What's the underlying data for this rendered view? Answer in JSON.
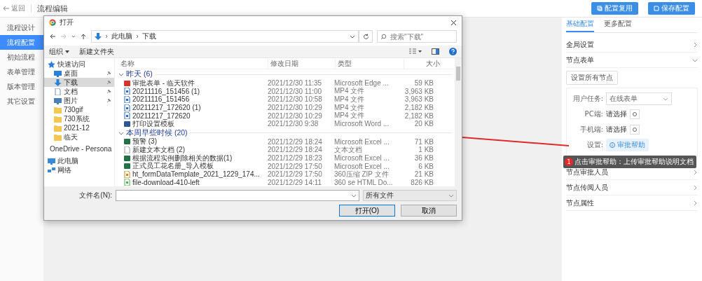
{
  "topbar": {
    "back": "返回",
    "title": "流程编辑",
    "buttons": [
      {
        "label": "配置复用",
        "kind": "copy"
      },
      {
        "label": "保存配置",
        "kind": "save"
      }
    ]
  },
  "sidebar": {
    "items": [
      {
        "label": "流程设计",
        "selected": false
      },
      {
        "label": "流程配置",
        "selected": true
      },
      {
        "label": "初始流程",
        "selected": false
      },
      {
        "label": "表单管理",
        "selected": false
      },
      {
        "label": "版本管理",
        "selected": false
      },
      {
        "label": "其它设置",
        "selected": false
      }
    ]
  },
  "panel": {
    "tabs": [
      {
        "label": "基础配置",
        "selected": true
      },
      {
        "label": "更多配置",
        "selected": false
      }
    ],
    "sections": [
      {
        "title": "全局设置",
        "expanded": false
      },
      {
        "title": "节点表单",
        "expanded": true,
        "content": {
          "button": "设置所有节点",
          "fields": [
            {
              "label": "用户任务:",
              "kind": "select",
              "value": "在线表单"
            },
            {
              "label": "PC端:",
              "kind": "picker",
              "value": "请选择"
            },
            {
              "label": "手机端:",
              "kind": "picker",
              "value": "请选择"
            },
            {
              "label": "设置:",
              "kind": "button",
              "value": "审批帮助"
            }
          ]
        }
      },
      {
        "title": "节点审批人员",
        "expanded": false
      },
      {
        "title": "节点传阅人员",
        "expanded": false
      },
      {
        "title": "节点属性",
        "expanded": false
      }
    ],
    "tooltip": {
      "badge": "1",
      "text": "点击审批帮助：上传审批帮助说明文档"
    }
  },
  "dialog": {
    "title": "打开",
    "path": [
      "此电脑",
      "下载"
    ],
    "search": {
      "placeholder": "搜索\"下载\""
    },
    "toolbar": [
      "组织",
      "新建文件夹"
    ],
    "nav": [
      {
        "label": "快速访问",
        "kind": "star",
        "pinned": false,
        "selected": false
      },
      {
        "label": "桌面",
        "kind": "desktop",
        "pinned": true,
        "selected": false
      },
      {
        "label": "下载",
        "kind": "download",
        "pinned": true,
        "selected": true
      },
      {
        "label": "文档",
        "kind": "document",
        "pinned": true,
        "selected": false
      },
      {
        "label": "图片",
        "kind": "picture",
        "pinned": true,
        "selected": false
      },
      {
        "label": "730gif",
        "kind": "folder",
        "pinned": false,
        "selected": false
      },
      {
        "label": "730系统",
        "kind": "folder",
        "pinned": false,
        "selected": false
      },
      {
        "label": "2021-12",
        "kind": "folder",
        "pinned": false,
        "selected": false
      },
      {
        "label": "临天",
        "kind": "folder",
        "pinned": false,
        "selected": false
      },
      {
        "label": "OneDrive - Persona",
        "kind": "cloud",
        "pinned": false,
        "selected": false
      },
      {
        "label": "此电脑",
        "kind": "computer",
        "pinned": false,
        "selected": false
      },
      {
        "label": "网络",
        "kind": "network",
        "pinned": false,
        "selected": false
      }
    ],
    "columns": [
      "名称",
      "修改日期",
      "类型",
      "大小"
    ],
    "groups": [
      {
        "label": "昨天 (6)",
        "expanded": true,
        "files": [
          {
            "name": "审批表单 - 临天软件",
            "date": "2021/12/30 11:35",
            "type": "Microsoft Edge ...",
            "size": "59 KB",
            "kind": "pdf"
          },
          {
            "name": "20211116_151456 (1)",
            "date": "2021/12/30 11:00",
            "type": "MP4 文件",
            "size": "3,963 KB",
            "kind": "video"
          },
          {
            "name": "20211116_151456",
            "date": "2021/12/30 10:58",
            "type": "MP4 文件",
            "size": "3,963 KB",
            "kind": "video"
          },
          {
            "name": "20211217_172620 (1)",
            "date": "2021/12/30 10:29",
            "type": "MP4 文件",
            "size": "2,182 KB",
            "kind": "video"
          },
          {
            "name": "20211217_172620",
            "date": "2021/12/30 10:29",
            "type": "MP4 文件",
            "size": "2,182 KB",
            "kind": "video"
          },
          {
            "name": "打印设置模板",
            "date": "2021/12/30 9:38",
            "type": "Microsoft Word ...",
            "size": "20 KB",
            "kind": "word"
          }
        ]
      },
      {
        "label": "本周早些时候 (20)",
        "expanded": true,
        "files": [
          {
            "name": "预警 (3)",
            "date": "2021/12/29 18:24",
            "type": "Microsoft Excel ...",
            "size": "71 KB",
            "kind": "excel"
          },
          {
            "name": "新建文本文档 (2)",
            "date": "2021/12/29 18:24",
            "type": "文本文档",
            "size": "1 KB",
            "kind": "text"
          },
          {
            "name": "根据流程实例删除相关的数据(1)",
            "date": "2021/12/29 18:23",
            "type": "Microsoft Excel ...",
            "size": "36 KB",
            "kind": "excel"
          },
          {
            "name": "正式员工花名册_导入模板",
            "date": "2021/12/29 17:50",
            "type": "Microsoft Excel ...",
            "size": "6 KB",
            "kind": "excel"
          },
          {
            "name": "ht_formDataTemplate_2021_1229_174...",
            "date": "2021/12/29 17:50",
            "type": "360压缩 ZIP 文件",
            "size": "21 KB",
            "kind": "archive"
          },
          {
            "name": "file-download-410-left",
            "date": "2021/12/29 14:11",
            "type": "360 se HTML Do...",
            "size": "826 KB",
            "kind": "web"
          }
        ]
      }
    ],
    "filename_label": "文件名(N):",
    "filter": "所有文件",
    "buttons": [
      {
        "label": "打开(O)",
        "kind": "primary"
      },
      {
        "label": "取消",
        "kind": "normal"
      }
    ]
  }
}
